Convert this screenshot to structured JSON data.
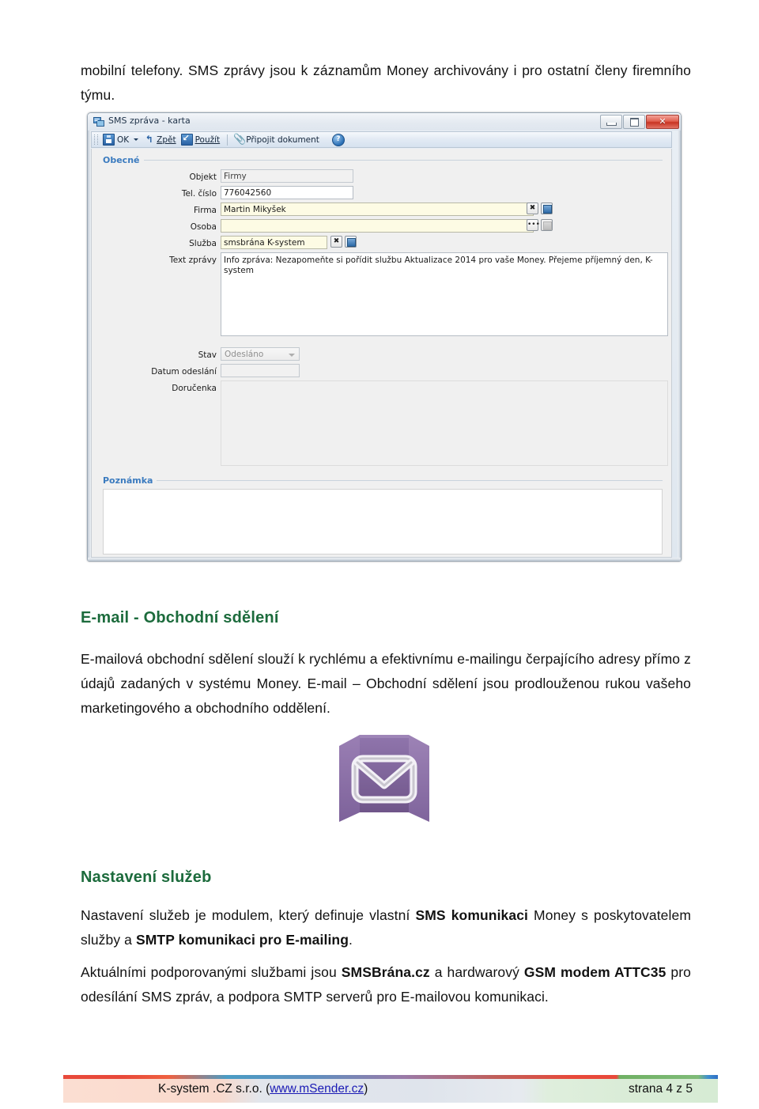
{
  "document": {
    "top_paragraph": "mobilní telefony. SMS zprávy jsou k záznamům Money archivovány i pro ostatní členy firemního týmu.",
    "section_email": {
      "heading": "E-mail - Obchodní sdělení",
      "paragraph_part1": "E-mailová obchodní sdělení slouží k rychlému a efektivnímu e-mailingu čerpajícího adresy přímo z údajů zadaných v systému Money. E-mail – Obchodní sdělení jsou prodlouženou rukou vašeho marketingového a obchodního oddělení."
    },
    "section_services": {
      "heading": "Nastavení služeb",
      "p1_a": "Nastavení služeb je modulem, který definuje vlastní ",
      "p1_b1": "SMS komunikaci",
      "p1_c": " Money s poskytovatelem služby a ",
      "p1_b2": "SMTP komunikaci pro E-mailing",
      "p1_d": ".",
      "p2_a": "Aktuálními podporovanými službami jsou ",
      "p2_b1": "SMSBrána.cz",
      "p2_c": " a hardwarový ",
      "p2_b2": "GSM modem ATTC35",
      "p2_d": " pro odesílání SMS zpráv, a podpora SMTP serverů pro E-mailovou komunikaci."
    }
  },
  "dialog": {
    "title": "SMS zpráva - karta",
    "window_buttons": {
      "minimize": "minimize-icon",
      "maximize": "maximize-icon",
      "close": "✕"
    },
    "toolbar": {
      "ok_label": "OK",
      "back_label": "Zpět",
      "apply_label": "Použít",
      "attach_label": "Připojit dokument",
      "help_label": "?"
    },
    "group_general": "Obecné",
    "group_note": "Poznámka",
    "fields": {
      "objekt": {
        "label": "Objekt",
        "value": "Firmy"
      },
      "tel_cislo": {
        "label": "Tel. číslo",
        "value": "776042560"
      },
      "firma": {
        "label": "Firma",
        "value": "Martin Mikyšek",
        "btn_clear": "✖",
        "btn_pick": "list-picker-icon"
      },
      "osoba": {
        "label": "Osoba",
        "value": "",
        "btn_more": "•••",
        "btn_pick": "list-picker-icon"
      },
      "sluzba": {
        "label": "Služba",
        "value": "smsbrána K-system",
        "btn_clear": "✖",
        "btn_pick": "list-picker-icon"
      },
      "text_zpravy": {
        "label": "Text zprávy",
        "value": "Info zpráva: Nezapomeňte si pořídit službu Aktualizace 2014 pro vaše Money. Přejeme příjemný den, K-system"
      },
      "stav": {
        "label": "Stav",
        "value": "Odesláno"
      },
      "datum_odeslani": {
        "label": "Datum odeslání",
        "value": ""
      },
      "dorucenka": {
        "label": "Doručenka",
        "value": ""
      },
      "poznamka": {
        "value": ""
      }
    }
  },
  "footer": {
    "company": "K-system .CZ s.r.o. (",
    "link": "www.mSender.cz",
    "company_end": ")",
    "page": "strana 4 z 5"
  },
  "colors": {
    "heading_green": "#1c6b3c",
    "link_blue": "#1b1bb5",
    "envelope_purple": "#8a6ea8",
    "dialog_accent_blue": "#3b7bbf"
  }
}
